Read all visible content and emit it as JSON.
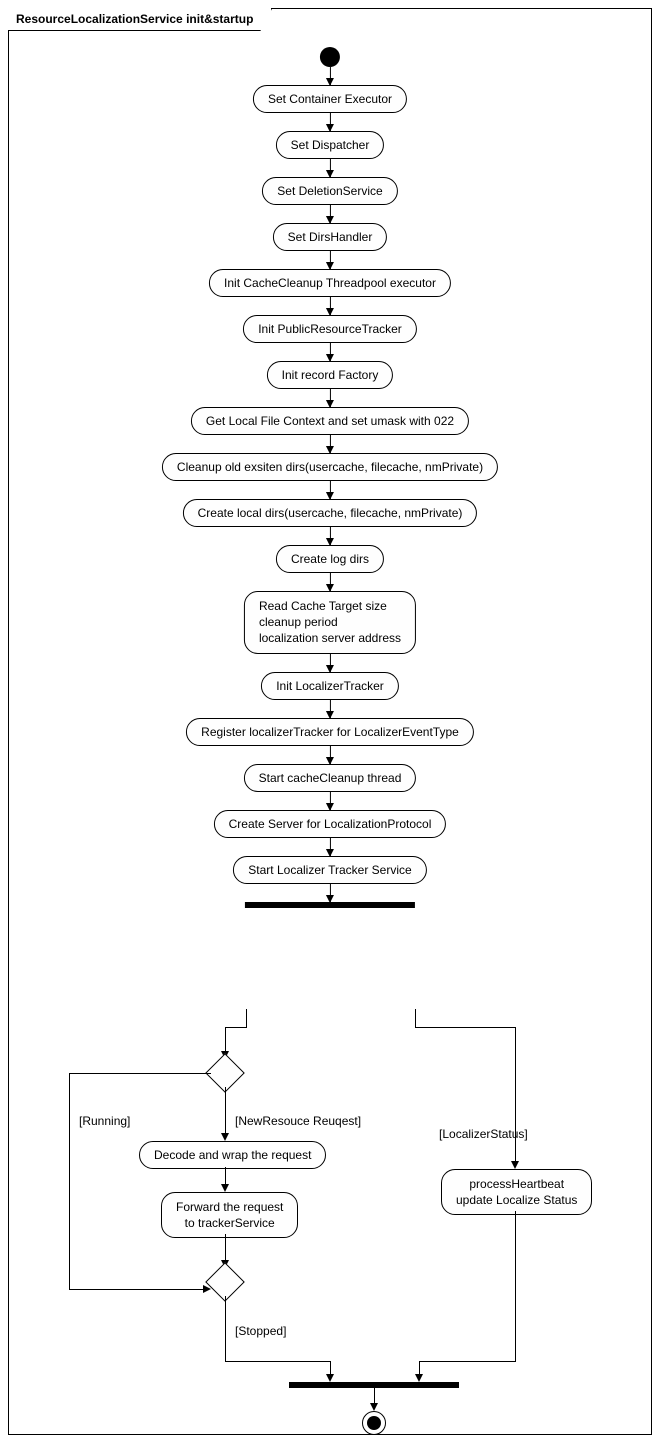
{
  "frame": {
    "title": "ResourceLocalizationService init&startup"
  },
  "steps": {
    "s1": "Set Container Executor",
    "s2": "Set Dispatcher",
    "s3": "Set DeletionService",
    "s4": "Set  DirsHandler",
    "s5": "Init CacheCleanup Threadpool executor",
    "s6": "Init PublicResourceTracker",
    "s7": "Init record Factory",
    "s8": "Get Local File Context and set umask with 022",
    "s9": "Cleanup old exsiten dirs(usercache, filecache, nmPrivate)",
    "s10": "Create local dirs(usercache, filecache, nmPrivate)",
    "s11": "Create log dirs",
    "s12": "Read Cache Target size\ncleanup period\nlocalization server address",
    "s13": "Init LocalizerTracker",
    "s14": "Register localizerTracker for LocalizerEventType",
    "s15": "Start cacheCleanup thread",
    "s16": "Create Server for LocalizationProtocol",
    "s17": "Start Localizer Tracker Service"
  },
  "branch": {
    "left": {
      "decode": "Decode and wrap the request",
      "forward": "Forward the request\nto trackerService"
    },
    "right": {
      "heartbeat": "processHeartbeat\nupdate Localize Status"
    }
  },
  "guards": {
    "running": "Running",
    "newReq": "NewResouce Reuqest",
    "localizerStatus": "LocalizerStatus",
    "stopped": "Stopped"
  }
}
